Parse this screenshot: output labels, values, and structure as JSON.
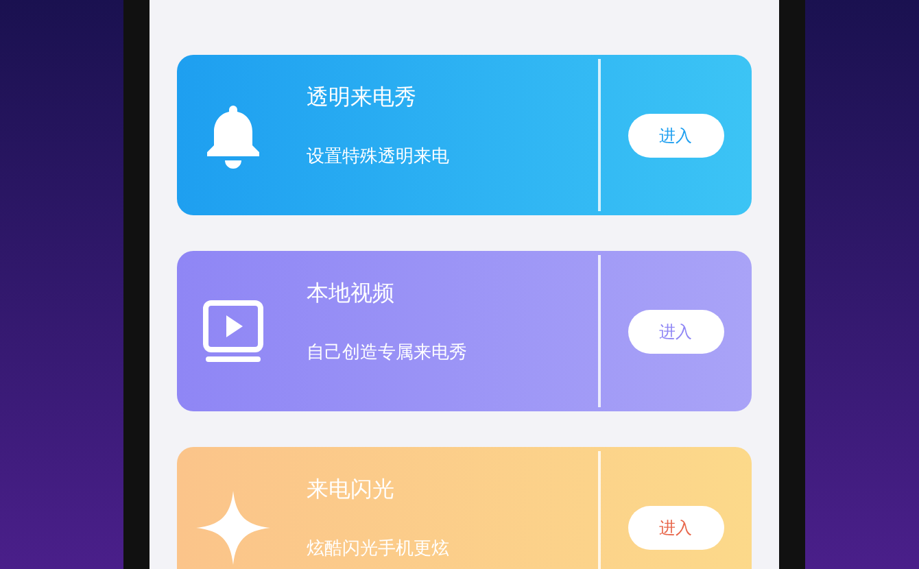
{
  "cards": [
    {
      "kind": "bell",
      "title": "透明来电秀",
      "subtitle": "设置特殊透明来电",
      "button": "进入"
    },
    {
      "kind": "video",
      "title": "本地视频",
      "subtitle": "自己创造专属来电秀",
      "button": "进入"
    },
    {
      "kind": "sparkle",
      "title": "来电闪光",
      "subtitle": "炫酷闪光手机更炫",
      "button": "进入"
    }
  ]
}
